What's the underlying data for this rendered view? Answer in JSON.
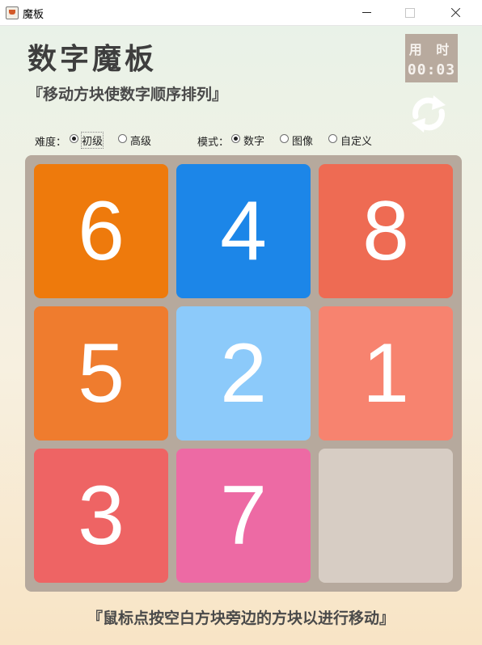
{
  "window": {
    "title": "魔板"
  },
  "header": {
    "app_title": "数字魔板",
    "subtitle": "『移动方块使数字顺序排列』"
  },
  "timer": {
    "label": "用 时",
    "value": "00:03"
  },
  "difficulty": {
    "label": "难度：",
    "options": [
      "初级",
      "高级"
    ],
    "selected": "初级"
  },
  "mode": {
    "label": "模式：",
    "options": [
      "数字",
      "图像",
      "自定义"
    ],
    "selected": "数字"
  },
  "board": {
    "tiles": [
      {
        "value": "6",
        "color": "#ee7a0c"
      },
      {
        "value": "4",
        "color": "#1c86e8"
      },
      {
        "value": "8",
        "color": "#ee6b53"
      },
      {
        "value": "5",
        "color": "#ef7c2e"
      },
      {
        "value": "2",
        "color": "#8ccafa"
      },
      {
        "value": "1",
        "color": "#f7836f"
      },
      {
        "value": "3",
        "color": "#ee6464"
      },
      {
        "value": "7",
        "color": "#ed6aa4"
      },
      {
        "value": "",
        "color": "#d7cdc4"
      }
    ]
  },
  "footer": {
    "hint": "『鼠标点按空白方块旁边的方块以进行移动』"
  },
  "icons": {
    "refresh": "refresh-icon",
    "app": "java-app-icon"
  }
}
